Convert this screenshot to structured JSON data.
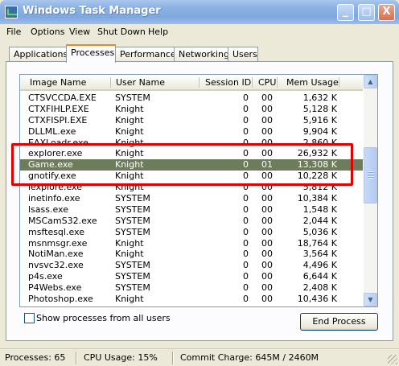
{
  "window": {
    "title": "Windows Task Manager",
    "icon": "task-manager-icon",
    "controls": [
      "_",
      "□",
      "X"
    ]
  },
  "menubar": {
    "items": [
      "File",
      "Options",
      "View",
      "Shut Down",
      "Help"
    ]
  },
  "tabs": [
    "Applications",
    "Processes",
    "Performance",
    "Networking",
    "Users"
  ],
  "active_tab": "Processes",
  "table": {
    "columns": [
      "Image Name",
      "User Name",
      "Session ID",
      "CPU",
      "Mem Usage"
    ],
    "rows": [
      [
        "CTSVCCDA.EXE",
        "SYSTEM",
        "0",
        "00",
        "1,632 K"
      ],
      [
        "CTXFIHLP.EXE",
        "Knight",
        "0",
        "00",
        "5,128 K"
      ],
      [
        "CTXFISPI.EXE",
        "Knight",
        "0",
        "00",
        "5,916 K"
      ],
      [
        "DLLML.exe",
        "Knight",
        "0",
        "00",
        "9,904 K"
      ],
      [
        "EAXLoadr.exe",
        "Knight",
        "0",
        "00",
        "2,860 K"
      ],
      [
        "explorer.exe",
        "Knight",
        "0",
        "00",
        "26,932 K"
      ],
      [
        "Game.exe",
        "Knight",
        "0",
        "01",
        "13,308 K"
      ],
      [
        "gnotify.exe",
        "Knight",
        "0",
        "00",
        "10,228 K"
      ],
      [
        "iexplore.exe",
        "Knight",
        "0",
        "00",
        "5,812 K"
      ],
      [
        "inetinfo.exe",
        "SYSTEM",
        "0",
        "00",
        "10,384 K"
      ],
      [
        "lsass.exe",
        "SYSTEM",
        "0",
        "00",
        "1,548 K"
      ],
      [
        "MSCamS32.exe",
        "SYSTEM",
        "0",
        "00",
        "2,044 K"
      ],
      [
        "msftesql.exe",
        "SYSTEM",
        "0",
        "00",
        "5,036 K"
      ],
      [
        "msnmsgr.exe",
        "Knight",
        "0",
        "00",
        "18,764 K"
      ],
      [
        "NotiMan.exe",
        "Knight",
        "0",
        "00",
        "3,564 K"
      ],
      [
        "nvsvc32.exe",
        "SYSTEM",
        "0",
        "00",
        "4,496 K"
      ],
      [
        "p4s.exe",
        "SYSTEM",
        "0",
        "00",
        "6,644 K"
      ],
      [
        "P4Webs.exe",
        "SYSTEM",
        "0",
        "00",
        "2,408 K"
      ],
      [
        "Photoshop.exe",
        "Knight",
        "0",
        "00",
        "10,436 K"
      ]
    ],
    "selected_row": 6
  },
  "show_all_label": "Show processes from all users",
  "show_all_checked": false,
  "end_process_label": "End Process",
  "status": {
    "processes": "Processes: 65",
    "cpu": "CPU Usage: 15%",
    "commit": "Commit Charge: 645M / 2460M"
  },
  "colors": {
    "selection": "#6d7d5b",
    "highlight_box": "#e00000",
    "active_tab_accent": "#e68b2c"
  }
}
